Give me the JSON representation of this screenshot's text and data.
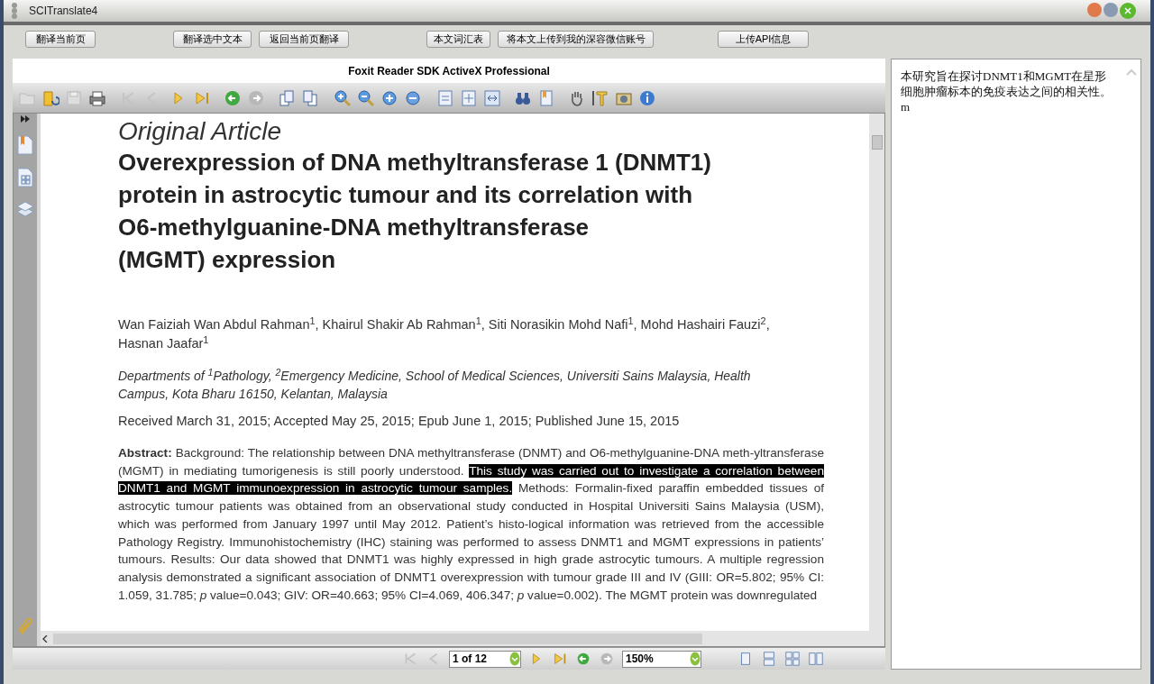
{
  "window": {
    "title": "SCITranslate4"
  },
  "buttons": [
    "翻译当前页",
    "翻译选中文本",
    "返回当前页翻译",
    "本文词汇表",
    "将本文上传到我的深容微信账号",
    "上传API信息"
  ],
  "viewer": {
    "title": "Foxit Reader SDK ActiveX Professional"
  },
  "document": {
    "kicker": "Original Article",
    "heading_lines": [
      "Overexpression of DNA methyltransferase 1 (DNMT1)",
      "protein in astrocytic tumour and its correlation with",
      "O6-methylguanine-DNA methyltransferase",
      "(MGMT) expression"
    ],
    "authors": "Wan Faiziah Wan Abdul Rahman$^{1}$, Khairul Shakir Ab Rahman$^{1}$, Siti Norasikin Mohd Nafi$^{1}$, Mohd Hashairi Fauzi$^{2}$, Hasnan Jaafar$^{1}$",
    "affiliation": "Departments of $^{1}$Pathology, $^{2}$Emergency Medicine, School of Medical Sciences, Universiti Sains Malaysia, Health Campus, Kota Bharu 16150, Kelantan, Malaysia",
    "dates": "Received March 31, 2015; Accepted May 25, 2015; Epub June 1, 2015; Published June 15, 2015",
    "abstract": [
      {
        "text": "**Abstract:** Background: The relationship between DNA methyltransferase (DNMT) and O6-methylguanine-DNA meth-yltransferase (MGMT) in mediating tumorigenesis is still poorly understood. ",
        "highlighted": false
      },
      {
        "text": "This study was carried out to investigate a correlation between DNMT1 and MGMT immunoexpression in astrocytic tumour samples.",
        "highlighted": true
      },
      {
        "text": " Methods: Formalin-fixed paraffin embedded tissues of astrocytic tumour patients was obtained from an observational study conducted in Hospital Universiti Sains Malaysia (USM), which was performed from January 1997 until May 2012. Patient’s histo-logical information was retrieved from the accessible Pathology Registry. Immunohistochemistry (IHC) staining was performed to assess DNMT1 and MGMT expressions in patients’ tumours. Results: Our data showed that DNMT1 was highly expressed in high grade astrocytic tumours. A multiple regression analysis demonstrated a significant association of DNMT1 overexpression with tumour grade III and IV (GIII: OR=5.802; 95% CI: 1.059, 31.785; *p* value=0.043; GIV: OR=40.663; 95% CI=4.069, 406.347; *p* value=0.002). The MGMT protein was downregulated",
        "highlighted": false
      }
    ]
  },
  "pager": {
    "page": "1 of 12",
    "zoom": "150%"
  },
  "translation": {
    "text": "本研究旨在探讨DNMT1和MGMT在星形细胞肿瘤标本的免疫表达之间的相关性。 m"
  }
}
